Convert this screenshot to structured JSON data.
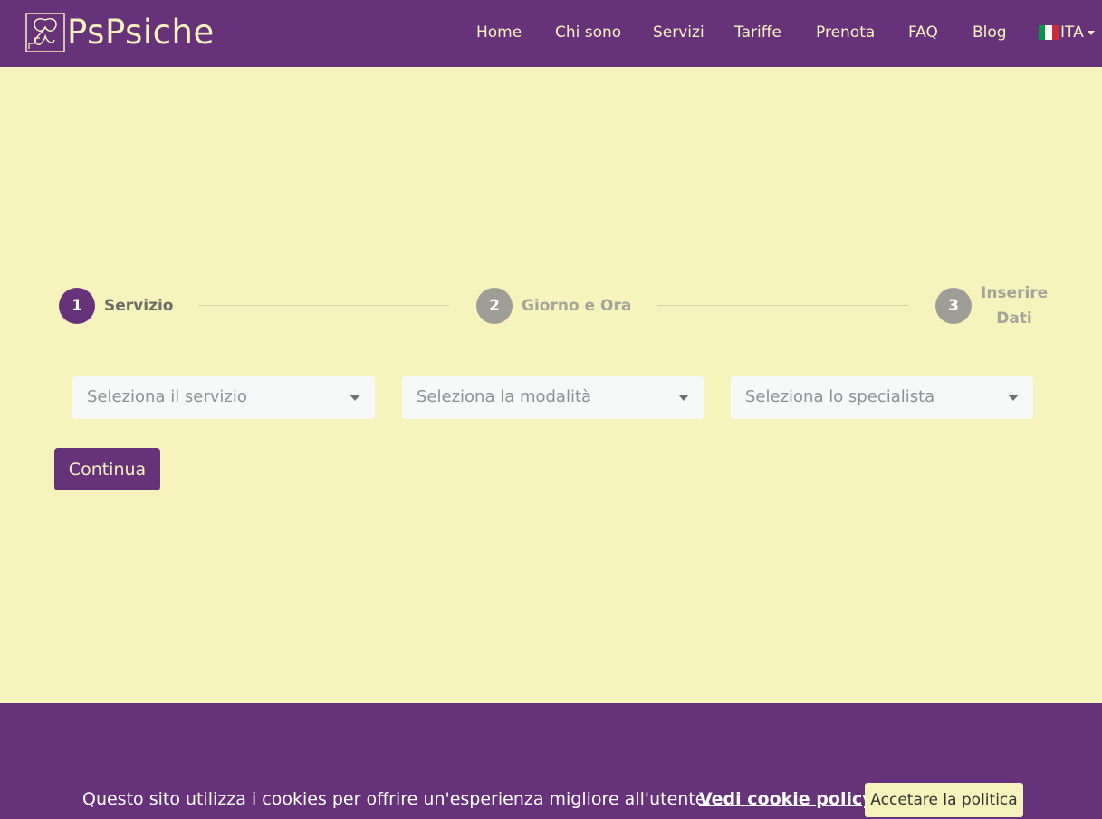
{
  "header": {
    "brand": "PsPsiche",
    "nav": [
      "Home",
      "Chi sono",
      "Servizi",
      "Tariffe",
      "Prenota",
      "FAQ",
      "Blog"
    ],
    "language": "ITA"
  },
  "stepper": {
    "steps": [
      {
        "number": "1",
        "label": "Servizio"
      },
      {
        "number": "2",
        "label": "Giorno e Ora"
      },
      {
        "number": "3",
        "label_line1": "Inserire",
        "label_line2": "Dati"
      }
    ]
  },
  "form": {
    "service_placeholder": "Seleziona il servizio",
    "mode_placeholder": "Seleziona la modalità",
    "specialist_placeholder": "Seleziona lo specialista",
    "continue_label": "Continua"
  },
  "cookie": {
    "message": "Questo sito utilizza i cookies per offrire un'esperienza migliore all'utente.",
    "link": "Vedi cookie policy",
    "accept": "Accetare la politica"
  },
  "colors": {
    "primary": "#66327a",
    "background": "#f6f3bd",
    "inactive_step": "#9e9e96"
  }
}
